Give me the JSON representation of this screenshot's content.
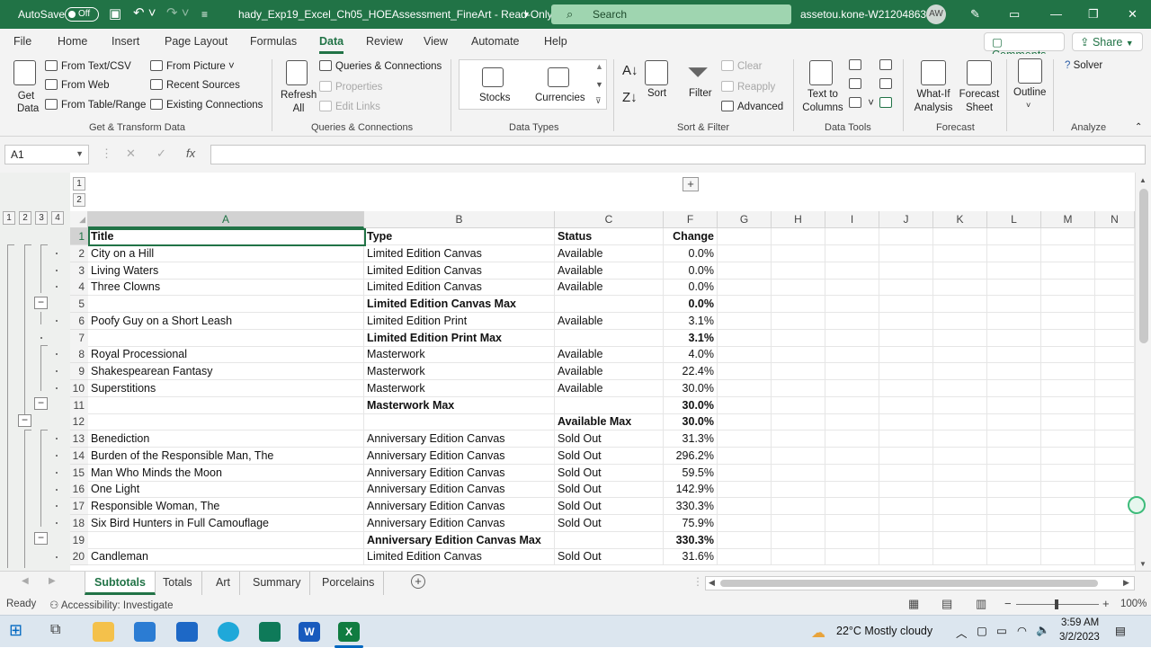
{
  "titlebar": {
    "autosave": "AutoSave",
    "toggle": "Off",
    "filename": "hady_Exp19_Excel_Ch05_HOEAssessment_FineArt - Read-Only",
    "search_placeholder": "Search",
    "account": "assetou.kone-W212048638",
    "initials": "AW"
  },
  "tabs": [
    "File",
    "Home",
    "Insert",
    "Page Layout",
    "Formulas",
    "Data",
    "Review",
    "View",
    "Automate",
    "Help"
  ],
  "active_tab": "Data",
  "actions": {
    "comments": "Comments",
    "share": "Share"
  },
  "ribbon": {
    "get_transform": {
      "get_data": "Get Data",
      "from_text": "From Text/CSV",
      "from_web": "From Web",
      "from_table": "From Table/Range",
      "from_picture": "From Picture",
      "recent": "Recent Sources",
      "existing": "Existing Connections",
      "group": "Get & Transform Data"
    },
    "queries": {
      "refresh": "Refresh All",
      "qc": "Queries & Connections",
      "properties": "Properties",
      "edit_links": "Edit Links",
      "group": "Queries & Connections"
    },
    "data_types": {
      "stocks": "Stocks",
      "currencies": "Currencies",
      "group": "Data Types"
    },
    "sort_filter": {
      "sort": "Sort",
      "filter": "Filter",
      "clear": "Clear",
      "reapply": "Reapply",
      "advanced": "Advanced",
      "group": "Sort & Filter"
    },
    "data_tools": {
      "text_to_columns": "Text to Columns",
      "group": "Data Tools"
    },
    "forecast": {
      "what_if": "What-If Analysis",
      "forecast_sheet": "Forecast Sheet",
      "group": "Forecast"
    },
    "outline": {
      "label": "Outline"
    },
    "analyze": {
      "solver": "Solver",
      "group": "Analyze"
    }
  },
  "formula_bar": {
    "name_box": "A1",
    "value": ""
  },
  "outline_levels": [
    "1",
    "2",
    "3",
    "4"
  ],
  "columns": [
    "A",
    "B",
    "C",
    "F",
    "G",
    "H",
    "I",
    "J",
    "K",
    "L",
    "M",
    "N"
  ],
  "rows": [
    {
      "n": "1",
      "a": "Title",
      "b": "Type",
      "c": "Status",
      "f": "Change",
      "bold": false,
      "header": true
    },
    {
      "n": "2",
      "a": "City on a Hill",
      "b": "Limited Edition Canvas",
      "c": "Available",
      "f": "0.0%"
    },
    {
      "n": "3",
      "a": "Living Waters",
      "b": "Limited Edition Canvas",
      "c": "Available",
      "f": "0.0%"
    },
    {
      "n": "4",
      "a": "Three Clowns",
      "b": "Limited Edition Canvas",
      "c": "Available",
      "f": "0.0%"
    },
    {
      "n": "5",
      "a": "",
      "b": "Limited Edition Canvas Max",
      "c": "",
      "f": "0.0%",
      "bold": true
    },
    {
      "n": "6",
      "a": "Poofy Guy on a Short Leash",
      "b": "Limited Edition Print",
      "c": "Available",
      "f": "3.1%"
    },
    {
      "n": "7",
      "a": "",
      "b": "Limited Edition Print Max",
      "c": "",
      "f": "3.1%",
      "bold": true
    },
    {
      "n": "8",
      "a": "Royal Processional",
      "b": "Masterwork",
      "c": "Available",
      "f": "4.0%"
    },
    {
      "n": "9",
      "a": "Shakespearean Fantasy",
      "b": "Masterwork",
      "c": "Available",
      "f": "22.4%"
    },
    {
      "n": "10",
      "a": "Superstitions",
      "b": "Masterwork",
      "c": "Available",
      "f": "30.0%"
    },
    {
      "n": "11",
      "a": "",
      "b": "Masterwork Max",
      "c": "",
      "f": "30.0%",
      "bold": true
    },
    {
      "n": "12",
      "a": "",
      "b": "",
      "c": "Available Max",
      "f": "30.0%",
      "bold": true
    },
    {
      "n": "13",
      "a": "Benediction",
      "b": "Anniversary Edition Canvas",
      "c": "Sold Out",
      "f": "31.3%"
    },
    {
      "n": "14",
      "a": "Burden of the Responsible Man, The",
      "b": "Anniversary Edition Canvas",
      "c": "Sold Out",
      "f": "296.2%"
    },
    {
      "n": "15",
      "a": "Man Who Minds the Moon",
      "b": "Anniversary Edition Canvas",
      "c": "Sold Out",
      "f": "59.5%"
    },
    {
      "n": "16",
      "a": "One Light",
      "b": "Anniversary Edition Canvas",
      "c": "Sold Out",
      "f": "142.9%"
    },
    {
      "n": "17",
      "a": "Responsible Woman, The",
      "b": "Anniversary Edition Canvas",
      "c": "Sold Out",
      "f": "330.3%"
    },
    {
      "n": "18",
      "a": "Six Bird Hunters in Full Camouflage",
      "b": "Anniversary Edition Canvas",
      "c": "Sold Out",
      "f": "75.9%"
    },
    {
      "n": "19",
      "a": "",
      "b": "Anniversary Edition Canvas Max",
      "c": "",
      "f": "330.3%",
      "bold": true
    },
    {
      "n": "20",
      "a": "Candleman",
      "b": "Limited Edition Canvas",
      "c": "Sold Out",
      "f": "31.6%"
    }
  ],
  "sheets": [
    "Subtotals",
    "Totals",
    "Art",
    "Summary",
    "Porcelains"
  ],
  "active_sheet": "Subtotals",
  "status": {
    "ready": "Ready",
    "accessibility": "Accessibility: Investigate",
    "zoom": "100%"
  },
  "taskbar": {
    "weather": "22°C  Mostly cloudy",
    "time": "3:59 AM",
    "date": "3/2/2023"
  },
  "colors": {
    "accent": "#217346"
  }
}
